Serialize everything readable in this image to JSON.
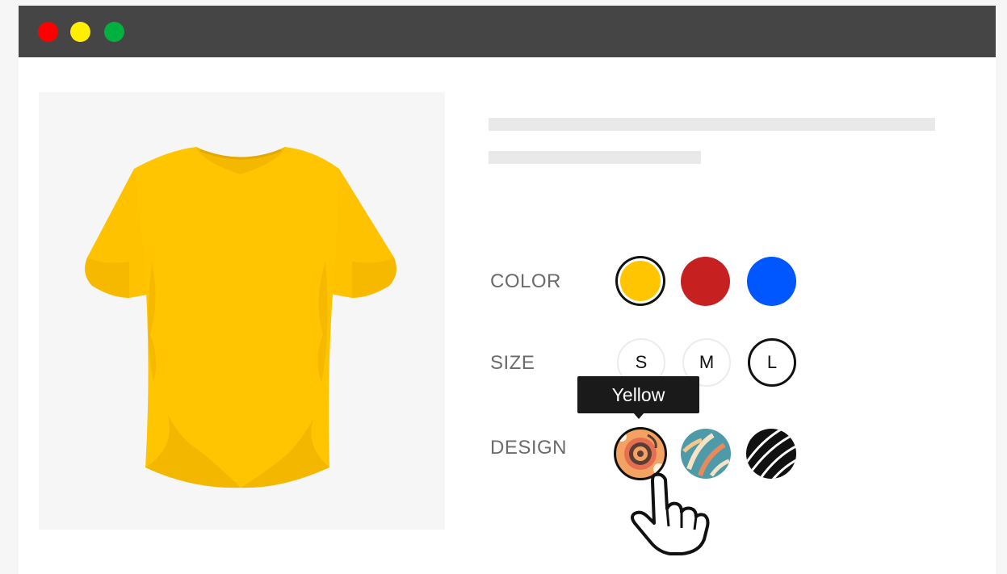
{
  "window": {
    "controls": [
      "close",
      "minimize",
      "maximize"
    ]
  },
  "product": {
    "image_icon": "tshirt-icon",
    "shirt_color": "#ffc500"
  },
  "options": {
    "color_label": "COLOR",
    "size_label": "SIZE",
    "design_label": "DESIGN",
    "colors": [
      {
        "name": "yellow",
        "hex": "#ffc500",
        "selected": true
      },
      {
        "name": "red",
        "hex": "#c62020",
        "selected": false
      },
      {
        "name": "blue",
        "hex": "#0056ff",
        "selected": false
      }
    ],
    "sizes": [
      {
        "label": "S",
        "selected": false
      },
      {
        "label": "M",
        "selected": false
      },
      {
        "label": "L",
        "selected": true
      }
    ],
    "designs": [
      {
        "name": "orange-floral-pattern",
        "selected": true
      },
      {
        "name": "teal-leaf-pattern",
        "selected": false
      },
      {
        "name": "black-white-stripes-pattern",
        "selected": false
      }
    ]
  },
  "tooltip": {
    "text": "Yellow"
  },
  "cursor": {
    "icon": "pointing-hand-icon"
  }
}
